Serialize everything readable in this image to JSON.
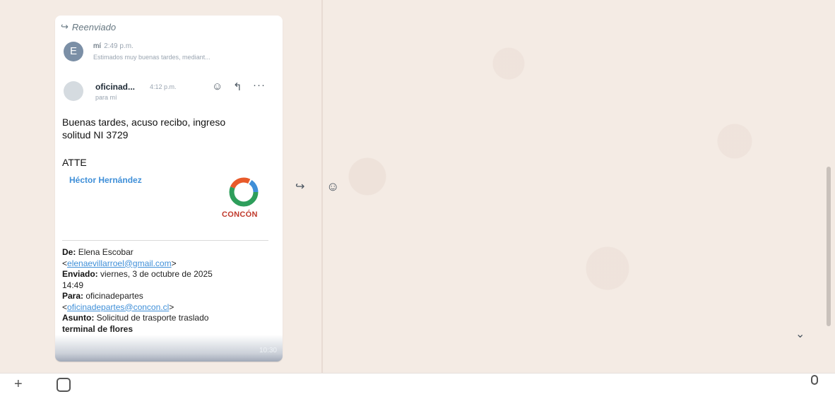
{
  "message": {
    "forwarded_label": "Reenviado",
    "thread": {
      "first": {
        "avatar_letter": "E",
        "sender": "mí",
        "time": "2:49 p.m.",
        "preview": "Estimados muy buenas tardes, mediant..."
      },
      "second": {
        "sender": "oficinad...",
        "time": "4:12 p.m.",
        "to": "para mí"
      }
    },
    "body_lines": [
      "Buenas tardes, acuso recibo, ingreso",
      "solitud NI 3729"
    ],
    "signoff": "ATTE",
    "signature": {
      "name": "Héctor Hernández",
      "logo_text": "CONCÓN"
    },
    "headers": {
      "from_label": "De:",
      "from_name": "Elena Escobar",
      "from_email": "elenaevillarroel@gmail.com",
      "sent_label": "Enviado:",
      "sent_value": "viernes, 3 de octubre de 2025",
      "sent_time": "14:49",
      "to_label": "Para:",
      "to_name": "oficinadepartes",
      "to_email": "oficinadepartes@concon.cl",
      "subject_label": "Asunto:",
      "subject_line1": "Solicitud de trasporte traslado",
      "subject_line2": "terminal de flores"
    },
    "timestamp": "10:30"
  },
  "icons": {
    "forward": "forward-icon",
    "emoji": "emoji-icon",
    "reply": "reply-icon",
    "more": "more-icon",
    "chevron": "chevron-down-icon",
    "plus": "plus-icon",
    "sticker": "sticker-icon",
    "mic": "mic-icon"
  },
  "colors": {
    "link": "#3f8fd8",
    "signature": "#3f8fd8",
    "logo": "#c0392b",
    "wallpaper": "#f4ebe4"
  }
}
